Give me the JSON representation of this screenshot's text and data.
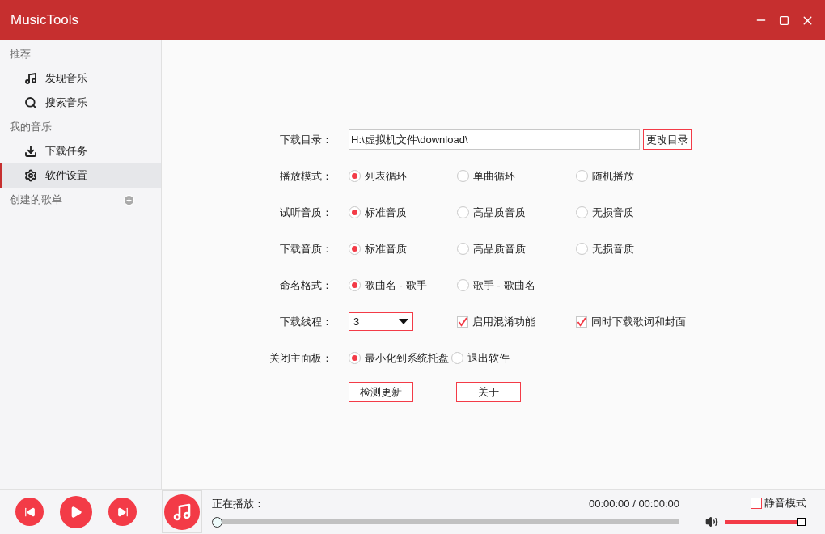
{
  "window": {
    "title": "MusicTools"
  },
  "sidebar": [
    {
      "kind": "section",
      "label": "推荐"
    },
    {
      "kind": "item",
      "label": "发现音乐",
      "selected": false
    },
    {
      "kind": "item",
      "label": "搜索音乐",
      "selected": false
    },
    {
      "kind": "section",
      "label": "我的音乐"
    },
    {
      "kind": "item",
      "label": "下载任务",
      "selected": false
    },
    {
      "kind": "item",
      "label": "软件设置",
      "selected": true
    },
    {
      "kind": "section_add",
      "label": "创建的歌单"
    }
  ],
  "settings": [
    {
      "kind": "path",
      "label": "下载目录：",
      "value": "H:\\虚拟机文件\\download\\",
      "button": "更改目录"
    },
    {
      "kind": "radio",
      "label": "播放模式：",
      "options": [
        {
          "label": "列表循环",
          "selected": true
        },
        {
          "label": "单曲循环",
          "selected": false
        },
        {
          "label": "随机播放",
          "selected": false
        }
      ]
    },
    {
      "kind": "radio",
      "label": "试听音质：",
      "options": [
        {
          "label": "标准音质",
          "selected": true
        },
        {
          "label": "高品质音质",
          "selected": false
        },
        {
          "label": "无损音质",
          "selected": false
        }
      ]
    },
    {
      "kind": "radio",
      "label": "下载音质：",
      "options": [
        {
          "label": "标准音质",
          "selected": true
        },
        {
          "label": "高品质音质",
          "selected": false
        },
        {
          "label": "无损音质",
          "selected": false
        }
      ]
    },
    {
      "kind": "radio",
      "label": "命名格式：",
      "options": [
        {
          "label": "歌曲名 - 歌手",
          "selected": true
        },
        {
          "label": "歌手 - 歌曲名",
          "selected": false
        }
      ]
    },
    {
      "kind": "select",
      "label": "下载线程：",
      "value": "3",
      "checkboxes": [
        {
          "label": "启用混淆功能",
          "checked": true
        },
        {
          "label": "同时下载歌词和封面",
          "checked": true
        }
      ]
    },
    {
      "kind": "radio_tight",
      "label": "关闭主面板：",
      "options": [
        {
          "label": "最小化到系统托盘",
          "selected": true
        },
        {
          "label": "退出软件",
          "selected": false
        }
      ]
    }
  ],
  "actions": [
    "检测更新",
    "关于"
  ],
  "player": {
    "now_playing": "正在播放：",
    "time": "00:00:00 / 00:00:00",
    "progress": {
      "level": 0
    },
    "volume": {
      "level": 0.97
    },
    "mute": {
      "label": "静音模式",
      "checked": false
    }
  }
}
